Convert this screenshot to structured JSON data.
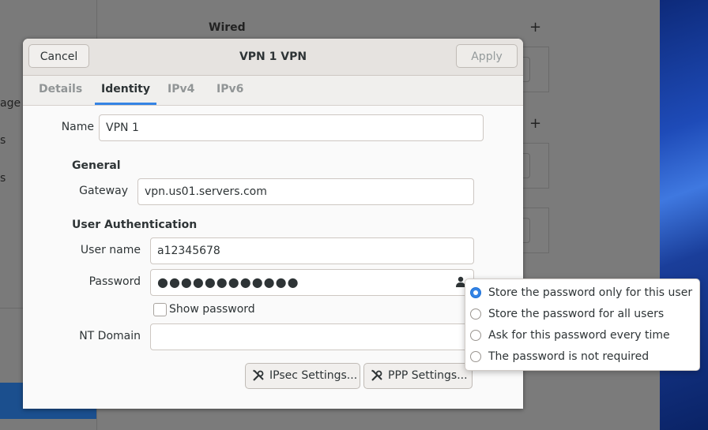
{
  "background": {
    "sidebar_fragments": [
      "age",
      "s",
      "s"
    ],
    "wired_heading": "Wired",
    "plus_symbol": "+"
  },
  "dialog": {
    "title": "VPN 1 VPN",
    "cancel_label": "Cancel",
    "apply_label": "Apply",
    "tabs": [
      {
        "label": "Details",
        "active": false
      },
      {
        "label": "Identity",
        "active": true
      },
      {
        "label": "IPv4",
        "active": false
      },
      {
        "label": "IPv6",
        "active": false
      }
    ],
    "name_label": "Name",
    "name_value": "VPN 1",
    "general_heading": "General",
    "gateway_label": "Gateway",
    "gateway_value": "vpn.us01.servers.com",
    "auth_heading": "User Authentication",
    "username_label": "User name",
    "username_value": "a12345678",
    "password_label": "Password",
    "password_masked": "●●●●●●●●●●●●",
    "show_password_label": "Show password",
    "nt_domain_label": "NT Domain",
    "nt_domain_value": "",
    "ipsec_button": "IPsec Settings...",
    "ppp_button": "PPP Settings..."
  },
  "password_popover": {
    "options": [
      {
        "label": "Store the password only for this user",
        "selected": true
      },
      {
        "label": "Store the password for all users",
        "selected": false
      },
      {
        "label": "Ask for this password every time",
        "selected": false
      },
      {
        "label": "The password is not required",
        "selected": false
      }
    ]
  },
  "colors": {
    "accent": "#3584e4",
    "selected_sidebar": "#1b4f8e"
  }
}
